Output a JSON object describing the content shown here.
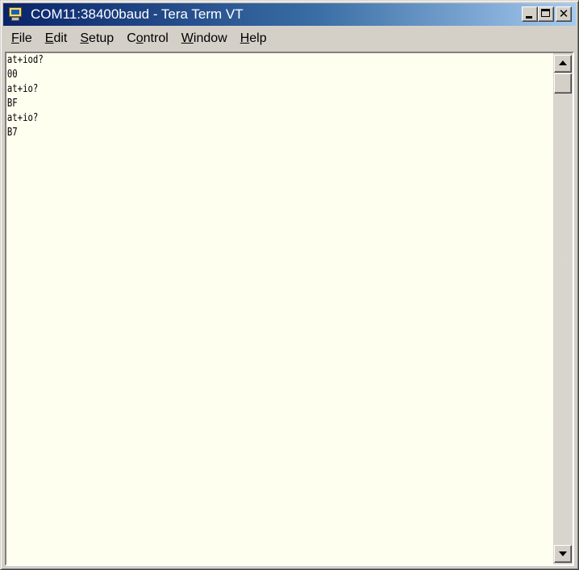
{
  "window": {
    "title": "COM11:38400baud - Tera Term VT",
    "icon": "tera-term-icon",
    "controls": {
      "minimize_icon": "minimize-icon",
      "maximize_icon": "maximize-icon",
      "close_glyph": "✕"
    }
  },
  "menu": {
    "items": [
      {
        "accel": "F",
        "rest": "ile"
      },
      {
        "accel": "E",
        "rest": "dit"
      },
      {
        "accel": "S",
        "rest": "etup"
      },
      {
        "prefix": "C",
        "accel": "o",
        "rest": "ntrol"
      },
      {
        "accel": "W",
        "rest": "indow"
      },
      {
        "accel": "H",
        "rest": "elp"
      }
    ]
  },
  "terminal": {
    "background": "#fffff0",
    "lines": [
      "at+iod?",
      "00",
      "at+io?",
      "BF",
      "at+io?",
      "B7"
    ]
  },
  "scrollbar": {
    "up_icon": "scroll-up-arrow-icon",
    "down_icon": "scroll-down-arrow-icon"
  }
}
